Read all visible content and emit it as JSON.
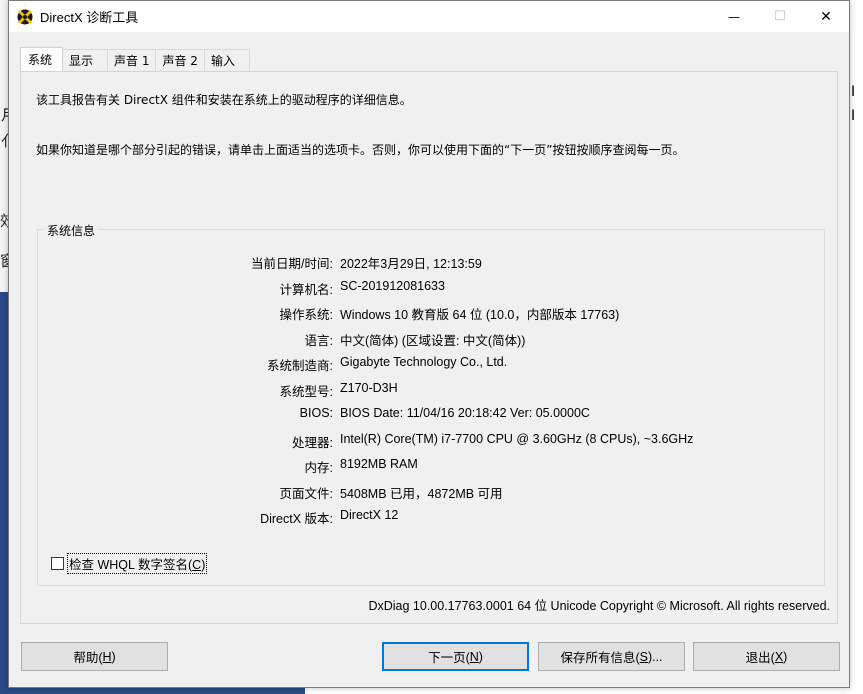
{
  "window": {
    "title": "DirectX 诊断工具",
    "minimize": "—",
    "maximize": "☐",
    "close": "✕"
  },
  "background": {
    "frag1": "月",
    "frag2": "亻",
    "frag3": "效",
    "frag4": "窗"
  },
  "tabs": [
    {
      "label": "系统"
    },
    {
      "label": "显示"
    },
    {
      "label": "声音 1"
    },
    {
      "label": "声音 2"
    },
    {
      "label": "输入"
    }
  ],
  "intro": {
    "line1": "该工具报告有关 DirectX 组件和安装在系统上的驱动程序的详细信息。",
    "line2": "如果你知道是哪个部分引起的错误，请单击上面适当的选项卡。否则，你可以使用下面的“下一页”按钮按顺序查阅每一页。"
  },
  "system_info": {
    "title": "系统信息",
    "rows": [
      {
        "label": "当前日期/时间:",
        "value": "2022年3月29日, 12:13:59"
      },
      {
        "label": "计算机名:",
        "value": "SC-201912081633"
      },
      {
        "label": "操作系统:",
        "value": "Windows 10 教育版 64 位 (10.0，内部版本 17763)"
      },
      {
        "label": "语言:",
        "value": "中文(简体) (区域设置: 中文(简体))"
      },
      {
        "label": "系统制造商:",
        "value": "Gigabyte Technology Co., Ltd."
      },
      {
        "label": "系统型号:",
        "value": "Z170-D3H"
      },
      {
        "label": "BIOS:",
        "value": "BIOS Date: 11/04/16 20:18:42 Ver: 05.0000C"
      },
      {
        "label": "处理器:",
        "value": "Intel(R) Core(TM) i7-7700 CPU @ 3.60GHz (8 CPUs), ~3.6GHz"
      },
      {
        "label": "内存:",
        "value": "8192MB RAM"
      },
      {
        "label": "页面文件:",
        "value": "5408MB 已用，4872MB 可用"
      },
      {
        "label": "DirectX 版本:",
        "value": "DirectX 12"
      }
    ]
  },
  "whql": {
    "label_prefix": "检查 WHQL 数字签名(",
    "label_key": "C",
    "label_suffix": ")"
  },
  "footer": "DxDiag 10.00.17763.0001 64 位 Unicode  Copyright © Microsoft. All rights reserved.",
  "buttons": {
    "help": {
      "prefix": "帮助(",
      "key": "H",
      "suffix": ")"
    },
    "next": {
      "prefix": "下一页(",
      "key": "N",
      "suffix": ")"
    },
    "save": {
      "prefix": "保存所有信息(",
      "key": "S",
      "suffix": ")..."
    },
    "exit": {
      "prefix": "退出(",
      "key": "X",
      "suffix": ")"
    }
  }
}
